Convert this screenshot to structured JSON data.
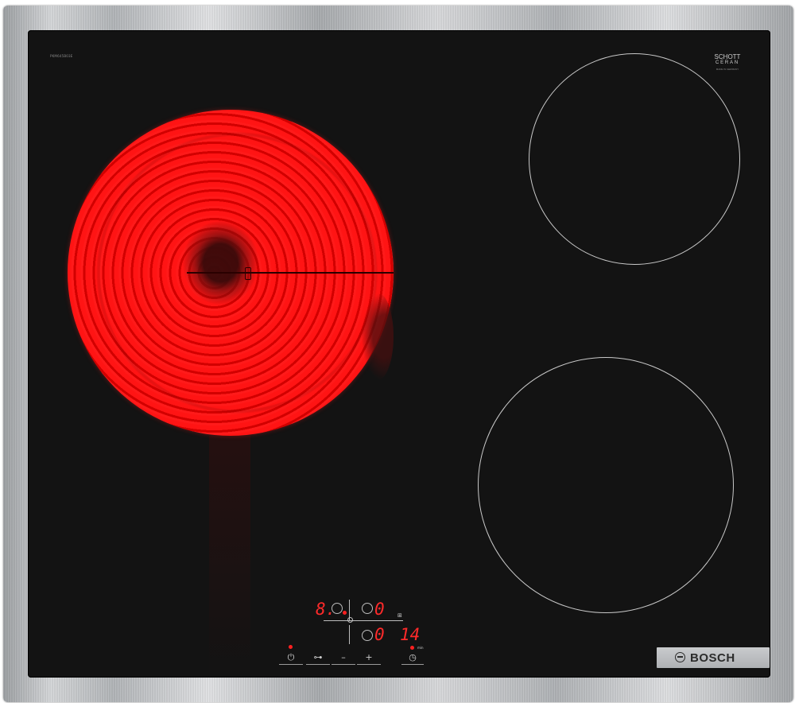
{
  "hob": {
    "model_number": "PKM645B03E",
    "glass_brand": {
      "line1": "SCHOTT",
      "line2": "CERAN",
      "line3": "MADE IN GERMANY"
    },
    "brand_name": "BOSCH",
    "brand_icon": "bosch-armature-icon",
    "colors": {
      "glass": "#131313",
      "heating": "#ff1414",
      "display": "#ff2a2a",
      "zone_outline": "#c9c9c9",
      "frame": "#c4c6c8"
    }
  },
  "display": {
    "power_level": "8.",
    "zone2_level": "0",
    "zone3_level": "0",
    "timer_zone_level": "0",
    "timer_minutes": "14",
    "timer_unit": "min"
  },
  "controls": {
    "power": "⏻",
    "lock": "⊶",
    "minus": "–",
    "plus": "+",
    "timer": "◷"
  }
}
